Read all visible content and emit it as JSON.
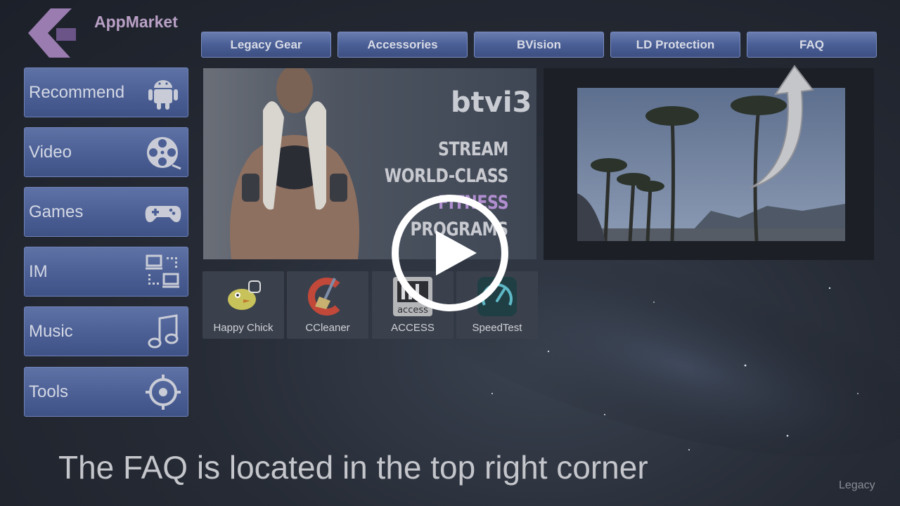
{
  "app": {
    "name": "AppMarket"
  },
  "topnav": {
    "items": [
      {
        "label": "Legacy Gear"
      },
      {
        "label": "Accessories"
      },
      {
        "label": "BVision"
      },
      {
        "label": "LD Protection"
      },
      {
        "label": "FAQ"
      }
    ]
  },
  "sidebar": {
    "items": [
      {
        "label": "Recommend",
        "icon": "android-icon"
      },
      {
        "label": "Video",
        "icon": "film-reel-icon"
      },
      {
        "label": "Games",
        "icon": "gamepad-icon"
      },
      {
        "label": "IM",
        "icon": "devices-icon"
      },
      {
        "label": "Music",
        "icon": "music-note-icon"
      },
      {
        "label": "Tools",
        "icon": "gear-icon"
      }
    ]
  },
  "banner": {
    "brand": "btvi3",
    "lines": [
      "STREAM",
      "WORLD-CLASS",
      "FITNESS",
      "PROGRAMS"
    ],
    "highlight_color": "#b08ed0"
  },
  "apps": [
    {
      "label": "Happy Chick",
      "icon": "chick-icon"
    },
    {
      "label": "CCleaner",
      "icon": "ccleaner-icon"
    },
    {
      "label": "ACCESS",
      "icon": "access-icon"
    },
    {
      "label": "SpeedTest",
      "icon": "speedometer-icon"
    }
  ],
  "caption": "The FAQ is located in the top right corner",
  "watermark": "Legacy",
  "colors": {
    "nav_button": "#4a5f96",
    "logo_purple": "#b9a0c6"
  }
}
